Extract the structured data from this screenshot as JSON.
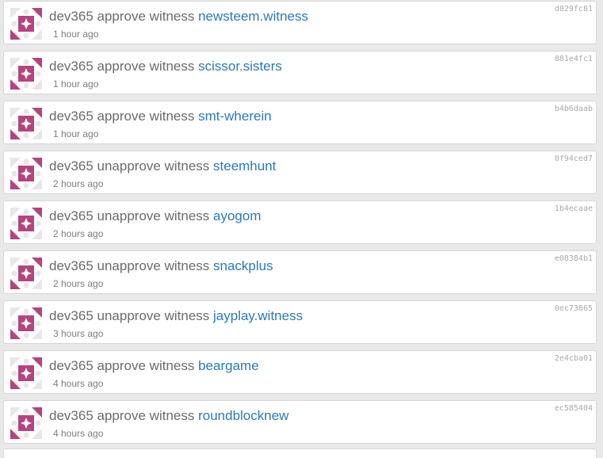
{
  "colors": {
    "link": "#2a7ab8",
    "text": "#6b6b6b",
    "muted": "#7e7e7e",
    "txid": "#a9a9a9",
    "avatar_primary": "#b5447e",
    "avatar_light": "#e9e6ea"
  },
  "operations": [
    {
      "actor": "dev365",
      "action": "approve witness",
      "witness": "newsteem.witness",
      "time": "1 hour ago",
      "txid": "d029fc81"
    },
    {
      "actor": "dev365",
      "action": "approve witness",
      "witness": "scissor.sisters",
      "time": "1 hour ago",
      "txid": "881e4fc1"
    },
    {
      "actor": "dev365",
      "action": "approve witness",
      "witness": "smt-wherein",
      "time": "1 hour ago",
      "txid": "b4b6daab"
    },
    {
      "actor": "dev365",
      "action": "unapprove witness",
      "witness": "steemhunt",
      "time": "2 hours ago",
      "txid": "0f94ced7"
    },
    {
      "actor": "dev365",
      "action": "unapprove witness",
      "witness": "ayogom",
      "time": "2 hours ago",
      "txid": "1b4ecaae"
    },
    {
      "actor": "dev365",
      "action": "unapprove witness",
      "witness": "snackplus",
      "time": "2 hours ago",
      "txid": "e08384b1"
    },
    {
      "actor": "dev365",
      "action": "unapprove witness",
      "witness": "jayplay.witness",
      "time": "3 hours ago",
      "txid": "0ec73865"
    },
    {
      "actor": "dev365",
      "action": "approve witness",
      "witness": "beargame",
      "time": "4 hours ago",
      "txid": "2e4cba01"
    },
    {
      "actor": "dev365",
      "action": "approve witness",
      "witness": "roundblocknew",
      "time": "4 hours ago",
      "txid": "ec585404"
    }
  ]
}
